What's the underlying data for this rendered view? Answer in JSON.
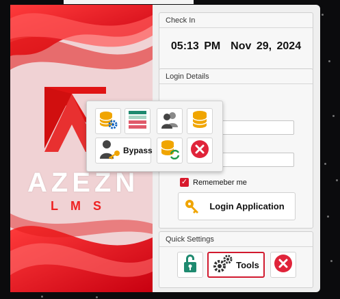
{
  "checkin": {
    "title": "Check In",
    "datetime": "05:13 PM  Nov 29, 2024"
  },
  "login": {
    "title": "Login Details",
    "username_value": "o",
    "password_value": "",
    "remember_label": "Rememeber me",
    "remember_checked": true,
    "login_button": "Login Application"
  },
  "quick": {
    "title": "Quick Settings",
    "tools_label": "Tools"
  },
  "popup": {
    "bypass_label": "Bypass"
  },
  "brand": {
    "name": "AZEZN",
    "sub": "LMS"
  },
  "colors": {
    "accent_red": "#d1192e",
    "gold": "#f0a500",
    "teal": "#1f8a70"
  },
  "icons": [
    "database-settings-icon",
    "list-icon",
    "users-icon",
    "database-icon",
    "user-key-icon",
    "database-refresh-icon",
    "close-icon",
    "key-icon",
    "unlock-icon",
    "gears-icon"
  ]
}
